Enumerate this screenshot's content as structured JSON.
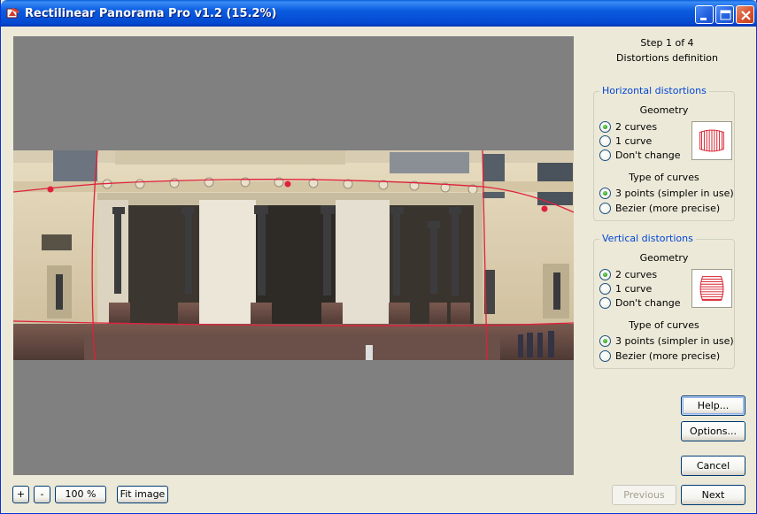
{
  "window": {
    "title": "Rectilinear Panorama Pro v1.2 (15.2%)"
  },
  "steps": {
    "step_label": "Step 1 of 4",
    "step_name": "Distortions definition"
  },
  "horizontal": {
    "legend": "Horizontal distortions",
    "geometry_title": "Geometry",
    "geometry_options": [
      "2 curves",
      "1 curve",
      "Don't change"
    ],
    "geometry_selected": "2 curves",
    "curves_title": "Type of curves",
    "curve_options": [
      "3 points (simpler in use)",
      "Bezier (more precise)"
    ],
    "curve_selected": "3 points (simpler in use)"
  },
  "vertical": {
    "legend": "Vertical distortions",
    "geometry_title": "Geometry",
    "geometry_options": [
      "2 curves",
      "1 curve",
      "Don't change"
    ],
    "geometry_selected": "2 curves",
    "curves_title": "Type of curves",
    "curve_options": [
      "3 points (simpler in use)",
      "Bezier (more precise)"
    ],
    "curve_selected": "3 points (simpler in use)"
  },
  "buttons": {
    "help": "Help...",
    "options": "Options...",
    "cancel": "Cancel",
    "previous": "Previous",
    "next": "Next",
    "zoom_in": "+",
    "zoom_out": "-",
    "zoom_level": "100 %",
    "fit_image": "Fit image"
  },
  "colors": {
    "titlebar": "#0a5fd8",
    "accent_legend": "#0046d5",
    "guide_curve": "#e0203c",
    "radio_selected": "#2e9c25"
  },
  "icons": {
    "app": "app-icon",
    "minimize": "minimize-icon",
    "maximize": "maximize-icon",
    "close": "close-icon"
  }
}
